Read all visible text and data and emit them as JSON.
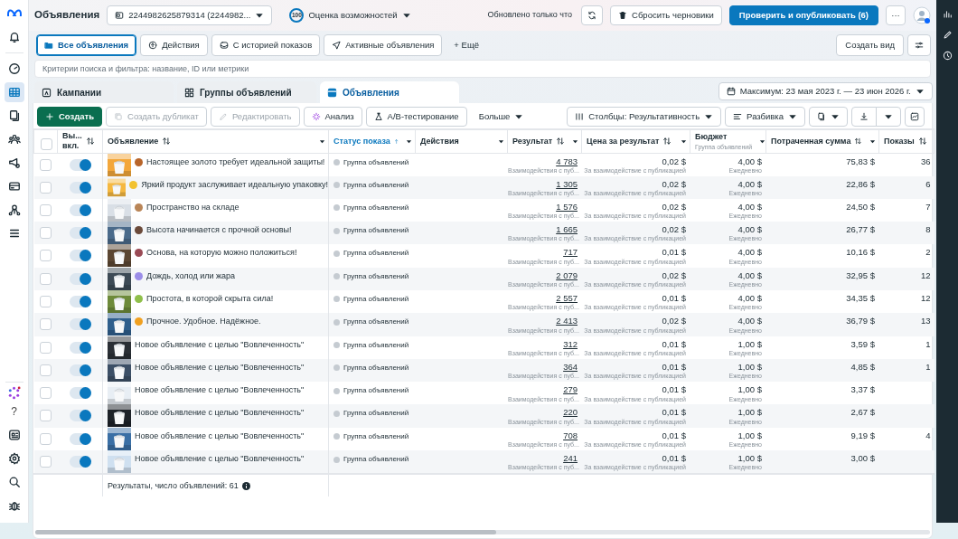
{
  "header": {
    "title": "Объявления",
    "account": "2244982625879314 (2244982...",
    "score": "100",
    "score_label": "Оценка возможностей",
    "updated": "Обновлено только что",
    "reset": "Сбросить черновики",
    "publish": "Проверить и опубликовать (6)",
    "more": "···"
  },
  "sidebar": {
    "items": [
      {
        "kind": "bell",
        "selected": false
      },
      {
        "kind": "gauge",
        "selected": false
      },
      {
        "kind": "grid",
        "selected": true
      },
      {
        "kind": "pages",
        "selected": false
      },
      {
        "kind": "people",
        "selected": false
      },
      {
        "kind": "megaphone",
        "selected": false
      },
      {
        "kind": "card",
        "selected": false
      },
      {
        "kind": "network",
        "selected": false
      },
      {
        "kind": "menu",
        "selected": false
      }
    ],
    "help": "?"
  },
  "filters": [
    {
      "label": "Все объявления",
      "selected": true
    },
    {
      "label": "Действия",
      "selected": false
    },
    {
      "label": "С историей показов",
      "selected": false
    },
    {
      "label": "Активные объявления",
      "selected": false
    }
  ],
  "more_filters": "+ Ещё",
  "create_view": "Создать вид",
  "search": {
    "placeholder": "Критерии поиска и фильтра: название, ID или метрики"
  },
  "level_tabs": [
    {
      "label": "Кампании",
      "selected": false
    },
    {
      "label": "Группы объявлений",
      "selected": false
    },
    {
      "label": "Объявления",
      "selected": true
    }
  ],
  "date_range": "Максимум: 23 мая 2023 г. — 23 июн 2026 г.",
  "toolbar": [
    {
      "label": "Создать",
      "kind": "primary",
      "disabled": false
    },
    {
      "label": "Создать дубликат",
      "kind": "copy",
      "disabled": true
    },
    {
      "label": "Редактировать",
      "kind": "edit",
      "disabled": true
    },
    {
      "label": "Анализ",
      "kind": "sparkle",
      "disabled": false
    },
    {
      "label": "A/B-тестирование",
      "kind": "flask",
      "disabled": false
    },
    {
      "label": "Больше",
      "kind": "menu",
      "disabled": false
    }
  ],
  "toolbar_right": {
    "columns": "Столбцы: Результативность",
    "breakdown": "Разбивка"
  },
  "table": {
    "all_checked": false,
    "columns": [
      {
        "label": "Вы... вкл.",
        "sortable": true,
        "ascending": false,
        "menu": false,
        "selected": false
      },
      {
        "label": "Объявление",
        "sortable": true,
        "ascending": false,
        "menu": true,
        "selected": false
      },
      {
        "label": "Статус показа",
        "sortable": true,
        "ascending": true,
        "menu": true,
        "selected": true
      },
      {
        "label": "Действия",
        "sortable": false,
        "menu": true,
        "selected": false
      },
      {
        "label": "Результат",
        "sortable": true,
        "ascending": false,
        "menu": true,
        "selected": false
      },
      {
        "label": "Цена за результат",
        "sortable": true,
        "ascending": false,
        "menu": true,
        "selected": false
      },
      {
        "label": "Бюджет",
        "sub": "Группа объявлений",
        "sortable": false,
        "menu": true,
        "selected": false
      },
      {
        "label": "Потраченная сумма",
        "sortable": true,
        "ascending": false,
        "menu": true,
        "selected": false
      },
      {
        "label": "Показы",
        "sortable": true,
        "ascending": false,
        "menu": false,
        "selected": false
      }
    ],
    "rows": [
      {
        "checked": false,
        "on": true,
        "color": "#b8652a",
        "name": "Настоящее золото требует идеальной защиты!",
        "status": "Группа объявлений",
        "result": "4 783",
        "result_note": "Взаимодействия с пуб...",
        "price": "0,02 $",
        "price_note": "За взаимодействие с публикацией",
        "budget": "4,00 $",
        "budget_note": "Ежедневно",
        "spent": "75,83 $",
        "shows": "36"
      },
      {
        "checked": false,
        "on": true,
        "color": "#f2c230",
        "name": "Яркий продукт заслуживает идеальную упаковку!",
        "status": "Группа объявлений",
        "result": "1 305",
        "result_note": "Взаимодействия с пуб...",
        "price": "0,02 $",
        "price_note": "За взаимодействие с публикацией",
        "budget": "4,00 $",
        "budget_note": "Ежедневно",
        "spent": "22,86 $",
        "shows": "6"
      },
      {
        "checked": false,
        "on": true,
        "color": "#b98557",
        "name": "Пространство на складе",
        "status": "Группа объявлений",
        "result": "1 576",
        "result_note": "Взаимодействия с пуб...",
        "price": "0,02 $",
        "price_note": "За взаимодействие с публикацией",
        "budget": "4,00 $",
        "budget_note": "Ежедневно",
        "spent": "24,50 $",
        "shows": "7"
      },
      {
        "checked": false,
        "on": true,
        "color": "#6b4a3a",
        "name": "Высота начинается с прочной основы!",
        "status": "Группа объявлений",
        "result": "1 665",
        "result_note": "Взаимодействия с пуб...",
        "price": "0,02 $",
        "price_note": "За взаимодействие с публикацией",
        "budget": "4,00 $",
        "budget_note": "Ежедневно",
        "spent": "26,77 $",
        "shows": "8"
      },
      {
        "checked": false,
        "on": true,
        "color": "#9a4a55",
        "name": "Основа, на которую можно положиться!",
        "status": "Группа объявлений",
        "result": "717",
        "result_note": "Взаимодействия с пуб...",
        "price": "0,01 $",
        "price_note": "За взаимодействие с публикацией",
        "budget": "4,00 $",
        "budget_note": "Ежедневно",
        "spent": "10,16 $",
        "shows": "2"
      },
      {
        "checked": false,
        "on": true,
        "color": "#9b8de8",
        "name": "Дождь, холод или жара",
        "status": "Группа объявлений",
        "result": "2 079",
        "result_note": "Взаимодействия с пуб...",
        "price": "0,02 $",
        "price_note": "За взаимодействие с публикацией",
        "budget": "4,00 $",
        "budget_note": "Ежедневно",
        "spent": "32,95 $",
        "shows": "12"
      },
      {
        "checked": false,
        "on": true,
        "color": "#8fbf4a",
        "name": "Простота, в которой скрыта сила!",
        "status": "Группа объявлений",
        "result": "2 557",
        "result_note": "Взаимодействия с пуб...",
        "price": "0,01 $",
        "price_note": "За взаимодействие с публикацией",
        "budget": "4,00 $",
        "budget_note": "Ежедневно",
        "spent": "34,35 $",
        "shows": "12"
      },
      {
        "checked": false,
        "on": true,
        "color": "#f0a020",
        "name": "Прочное. Удобное. Надёжное.",
        "status": "Группа объявлений",
        "result": "2 413",
        "result_note": "Взаимодействия с пуб...",
        "price": "0,02 $",
        "price_note": "За взаимодействие с публикацией",
        "budget": "4,00 $",
        "budget_note": "Ежедневно",
        "spent": "36,79 $",
        "shows": "13"
      },
      {
        "checked": false,
        "on": true,
        "name": "Новое объявление с целью \"Вовлеченность\"",
        "status": "Группа объявлений",
        "result": "312",
        "result_note": "Взаимодействия с пуб...",
        "price": "0,01 $",
        "price_note": "За взаимодействие с публикацией",
        "budget": "1,00 $",
        "budget_note": "Ежедневно",
        "spent": "3,59 $",
        "shows": "1"
      },
      {
        "checked": false,
        "on": true,
        "name": "Новое объявление с целью \"Вовлеченность\"",
        "status": "Группа объявлений",
        "result": "364",
        "result_note": "Взаимодействия с пуб...",
        "price": "0,01 $",
        "price_note": "За взаимодействие с публикацией",
        "budget": "1,00 $",
        "budget_note": "Ежедневно",
        "spent": "4,85 $",
        "shows": "1"
      },
      {
        "checked": false,
        "on": true,
        "name": "Новое объявление с целью \"Вовлеченность\"",
        "status": "Группа объявлений",
        "result": "279",
        "result_note": "Взаимодействия с пуб...",
        "price": "0,01 $",
        "price_note": "За взаимодействие с публикацией",
        "budget": "1,00 $",
        "budget_note": "Ежедневно",
        "spent": "3,37 $"
      },
      {
        "checked": false,
        "on": true,
        "name": "Новое объявление с целью \"Вовлеченность\"",
        "status": "Группа объявлений",
        "result": "220",
        "result_note": "Взаимодействия с пуб...",
        "price": "0,01 $",
        "price_note": "За взаимодействие с публикацией",
        "budget": "1,00 $",
        "budget_note": "Ежедневно",
        "spent": "2,67 $"
      },
      {
        "checked": false,
        "on": true,
        "name": "Новое объявление с целью \"Вовлеченность\"",
        "status": "Группа объявлений",
        "result": "708",
        "result_note": "Взаимодействия с пуб...",
        "price": "0,01 $",
        "price_note": "За взаимодействие с публикацией",
        "budget": "1,00 $",
        "budget_note": "Ежедневно",
        "spent": "9,19 $",
        "shows": "4"
      },
      {
        "checked": false,
        "on": true,
        "name": "Новое объявление с целью \"Вовлеченность\"",
        "status": "Группа объявлений",
        "result": "241",
        "result_note": "Взаимодействия с пуб...",
        "price": "0,01 $",
        "price_note": "За взаимодействие с публикацией",
        "budget": "1,00 $",
        "budget_note": "Ежедневно",
        "spent": "3,00 $"
      }
    ],
    "footer": "Результаты, число объявлений: 61"
  }
}
